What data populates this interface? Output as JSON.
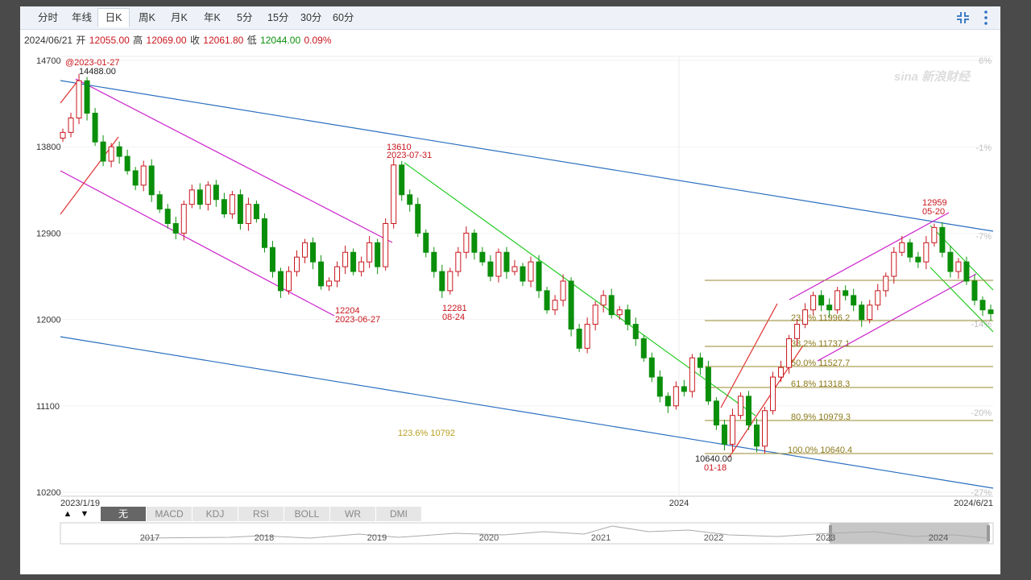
{
  "tabs": [
    {
      "label": "分时",
      "active": false
    },
    {
      "label": "年线",
      "active": false
    },
    {
      "label": "日K",
      "active": true
    },
    {
      "label": "周K",
      "active": false
    },
    {
      "label": "月K",
      "active": false
    },
    {
      "label": "年K",
      "active": false
    },
    {
      "label": "5分",
      "active": false
    },
    {
      "label": "15分",
      "active": false
    },
    {
      "label": "30分",
      "active": false
    },
    {
      "label": "60分",
      "active": false
    }
  ],
  "toolbar": {
    "fullscreen_icon": "fullscreen-icon",
    "menu_icon": "more-vertical-icon"
  },
  "quote": {
    "date": "2024/06/21",
    "open_label": "开",
    "open": "12055.00",
    "high_label": "高",
    "high": "12069.00",
    "close_label": "收",
    "close": "12061.80",
    "low_label": "低",
    "low": "12044.00",
    "change": "0.09%"
  },
  "colors": {
    "up": "#c8161d",
    "down": "#0a8f0a",
    "channel": "#cc22cc",
    "trend": "#2a6fbf",
    "green_line": "#22cc22",
    "fib": "#8b7a1a"
  },
  "watermark": "sina 新浪财经",
  "chart_data": {
    "type": "candlestick",
    "y_ticks": [
      "14700",
      "13800",
      "12900",
      "12000",
      "11100",
      "10200"
    ],
    "pct_ticks": [
      "6%",
      "-1%",
      "-7%",
      "-14%",
      "-20%",
      "-27%"
    ],
    "x_labels": [
      "2023/1/19",
      "2024",
      "2024/6/21"
    ],
    "ylim": [
      10200,
      14700
    ],
    "annotations": [
      {
        "label": "@2023-01-27",
        "value": "14488.00"
      },
      {
        "label": "13610",
        "value": "2023-07-31"
      },
      {
        "label": "12204",
        "value": "2023-06-27"
      },
      {
        "label": "12281",
        "value": "08-24"
      },
      {
        "label": "10640.00",
        "value": "01-18"
      },
      {
        "label": "12959",
        "value": "05-20"
      }
    ],
    "fibonacci": [
      {
        "label": "23.6%",
        "value": "11996.2"
      },
      {
        "label": "38.2%",
        "value": "11737.1"
      },
      {
        "label": "50.0%",
        "value": "11527.7"
      },
      {
        "label": "61.8%",
        "value": "11318.3"
      },
      {
        "label": "80.9%",
        "value": "10979.3"
      },
      {
        "label": "100.0%",
        "value": "10640.4"
      },
      {
        "label": "123.6%",
        "value": "10792"
      }
    ],
    "series": [
      {
        "points": [
          [
            0,
            13950
          ],
          [
            1,
            14100
          ],
          [
            2,
            14488
          ],
          [
            3,
            14150
          ],
          [
            4,
            13850
          ],
          [
            5,
            13650
          ],
          [
            6,
            13800
          ],
          [
            7,
            13700
          ],
          [
            8,
            13550
          ],
          [
            9,
            13400
          ],
          [
            10,
            13600
          ],
          [
            11,
            13300
          ],
          [
            12,
            13150
          ],
          [
            13,
            13000
          ],
          [
            14,
            12900
          ],
          [
            15,
            13200
          ],
          [
            16,
            13350
          ],
          [
            17,
            13200
          ],
          [
            18,
            13400
          ],
          [
            19,
            13250
          ],
          [
            20,
            13100
          ],
          [
            21,
            13300
          ],
          [
            22,
            13000
          ],
          [
            23,
            13200
          ],
          [
            24,
            13050
          ],
          [
            25,
            12750
          ],
          [
            26,
            12500
          ],
          [
            27,
            12300
          ],
          [
            28,
            12500
          ],
          [
            29,
            12650
          ],
          [
            30,
            12800
          ],
          [
            31,
            12600
          ],
          [
            32,
            12350
          ],
          [
            33,
            12400
          ],
          [
            34,
            12550
          ],
          [
            35,
            12700
          ],
          [
            36,
            12500
          ],
          [
            37,
            12600
          ],
          [
            38,
            12800
          ],
          [
            39,
            12550
          ],
          [
            40,
            13000
          ],
          [
            41,
            13610
          ],
          [
            42,
            13300
          ],
          [
            43,
            13200
          ],
          [
            44,
            12900
          ],
          [
            45,
            12700
          ],
          [
            46,
            12500
          ],
          [
            47,
            12300
          ],
          [
            48,
            12500
          ],
          [
            49,
            12700
          ],
          [
            50,
            12900
          ],
          [
            51,
            12700
          ],
          [
            52,
            12600
          ],
          [
            53,
            12450
          ],
          [
            54,
            12700
          ],
          [
            55,
            12500
          ],
          [
            56,
            12550
          ],
          [
            57,
            12400
          ],
          [
            58,
            12600
          ],
          [
            59,
            12300
          ],
          [
            60,
            12100
          ],
          [
            61,
            12200
          ],
          [
            62,
            12400
          ],
          [
            63,
            11900
          ],
          [
            64,
            11700
          ],
          [
            65,
            11950
          ],
          [
            66,
            12150
          ],
          [
            67,
            12250
          ],
          [
            68,
            12050
          ],
          [
            69,
            12100
          ],
          [
            70,
            11950
          ],
          [
            71,
            11800
          ],
          [
            72,
            11600
          ],
          [
            73,
            11400
          ],
          [
            74,
            11200
          ],
          [
            75,
            11100
          ],
          [
            76,
            11300
          ],
          [
            77,
            11250
          ],
          [
            78,
            11600
          ],
          [
            79,
            11500
          ],
          [
            80,
            11150
          ],
          [
            81,
            10900
          ],
          [
            82,
            10700
          ],
          [
            83,
            11000
          ],
          [
            84,
            11200
          ],
          [
            85,
            10900
          ],
          [
            86,
            10680
          ],
          [
            87,
            11050
          ],
          [
            88,
            11400
          ],
          [
            89,
            11500
          ],
          [
            90,
            11800
          ],
          [
            91,
            11950
          ],
          [
            92,
            12100
          ],
          [
            93,
            12250
          ],
          [
            94,
            12150
          ],
          [
            95,
            12100
          ],
          [
            96,
            12300
          ],
          [
            97,
            12250
          ],
          [
            98,
            12150
          ],
          [
            99,
            12000
          ],
          [
            100,
            12150
          ],
          [
            101,
            12300
          ],
          [
            102,
            12450
          ],
          [
            103,
            12700
          ],
          [
            104,
            12800
          ],
          [
            105,
            12650
          ],
          [
            106,
            12600
          ],
          [
            107,
            12800
          ],
          [
            108,
            12959
          ],
          [
            109,
            12700
          ],
          [
            110,
            12500
          ],
          [
            111,
            12600
          ],
          [
            112,
            12400
          ],
          [
            113,
            12200
          ],
          [
            114,
            12100
          ],
          [
            115,
            12061
          ]
        ]
      }
    ]
  },
  "indicators": {
    "up_arrow": "▲",
    "down_arrow": "▼",
    "items": [
      "无",
      "MACD",
      "KDJ",
      "RSI",
      "BOLL",
      "WR",
      "DMI"
    ]
  },
  "navigator": {
    "years": [
      "2017",
      "2018",
      "2019",
      "2020",
      "2021",
      "2022",
      "2023",
      "2024"
    ]
  }
}
